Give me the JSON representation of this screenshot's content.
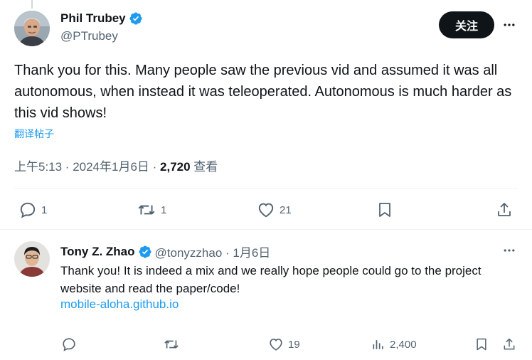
{
  "main_tweet": {
    "author_name": "Phil Trubey",
    "author_handle": "@PTrubey",
    "follow_label": "关注",
    "text": "Thank you for this. Many people saw the previous vid and assumed it was all autonomous, when instead it was teleoperated. Autonomous is much harder as this vid shows!",
    "translate_label": "翻译帖子",
    "timestamp": "上午5:13 · 2024年1月6日 · ",
    "views_count": "2,720",
    "views_label": " 查看",
    "actions": {
      "reply_count": "1",
      "retweet_count": "1",
      "like_count": "21"
    }
  },
  "reply_tweet": {
    "author_name": "Tony Z. Zhao",
    "author_handle": "@tonyzzhao · 1月6日",
    "text": "Thank you! It is indeed a mix and we really hope people could go to the project website and read the paper/code!",
    "link_text": "mobile-aloha.github.io",
    "actions": {
      "like_count": "19",
      "views_count": "2,400"
    }
  },
  "colors": {
    "text_primary": "#0f1419",
    "text_secondary": "#536471",
    "accent": "#1d9bf0",
    "divider": "#eff3f4",
    "follow_button_bg": "#0f1419"
  },
  "icons": [
    "verified-badge-icon",
    "more-icon",
    "reply-icon",
    "retweet-icon",
    "like-icon",
    "bookmark-icon",
    "share-icon",
    "views-icon"
  ]
}
